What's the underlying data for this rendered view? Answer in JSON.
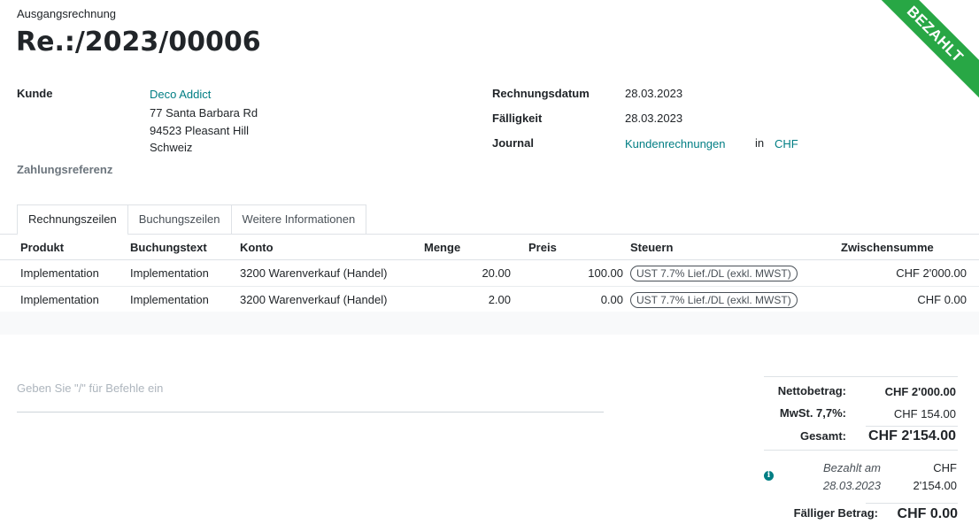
{
  "header": {
    "doc_type": "Ausgangsrechnung",
    "doc_name": "Re.:/2023/00006",
    "status_ribbon": "BEZAHLT"
  },
  "customer": {
    "label": "Kunde",
    "name": "Deco Addict",
    "address_line1": "77 Santa Barbara Rd",
    "address_line2": "94523 Pleasant Hill",
    "address_line3": "Schweiz",
    "payment_ref_label": "Zahlungsreferenz"
  },
  "info": {
    "invoice_date_label": "Rechnungsdatum",
    "invoice_date": "28.03.2023",
    "due_label": "Fälligkeit",
    "due_date": "28.03.2023",
    "journal_label": "Journal",
    "journal": "Kundenrechnungen",
    "in_label": "in",
    "currency": "CHF"
  },
  "tabs": [
    {
      "label": "Rechnungszeilen"
    },
    {
      "label": "Buchungszeilen"
    },
    {
      "label": "Weitere Informationen"
    }
  ],
  "table": {
    "columns": [
      "Produkt",
      "Buchungstext",
      "Konto",
      "Menge",
      "Preis",
      "Steuern",
      "Zwischensumme"
    ],
    "rows": [
      {
        "product": "Implementation",
        "label": "Implementation",
        "account": "3200 Warenverkauf (Handel)",
        "qty": "20.00",
        "price": "100.00",
        "tax": "UST 7.7% Lief./DL (exkl. MWST)",
        "subtotal": "CHF 2'000.00"
      },
      {
        "product": "Implementation",
        "label": "Implementation",
        "account": "3200 Warenverkauf (Handel)",
        "qty": "2.00",
        "price": "0.00",
        "tax": "UST 7.7% Lief./DL (exkl. MWST)",
        "subtotal": "CHF 0.00"
      }
    ]
  },
  "note_placeholder": "Geben Sie \"/\" für Befehle ein",
  "totals": {
    "net_label": "Nettobetrag:",
    "net": "CHF 2'000.00",
    "tax_label": "MwSt. 7,7%:",
    "tax": "CHF 154.00",
    "total_label": "Gesamt:",
    "total": "CHF 2'154.00",
    "paid_on_label": "Bezahlt am",
    "paid_on_date": "28.03.2023",
    "paid_currency": "CHF",
    "paid_amount": "2'154.00",
    "due_label": "Fälliger Betrag:",
    "due_amount": "CHF 0.00"
  },
  "colors": {
    "accent": "#017e84",
    "ribbon": "#28a745"
  }
}
